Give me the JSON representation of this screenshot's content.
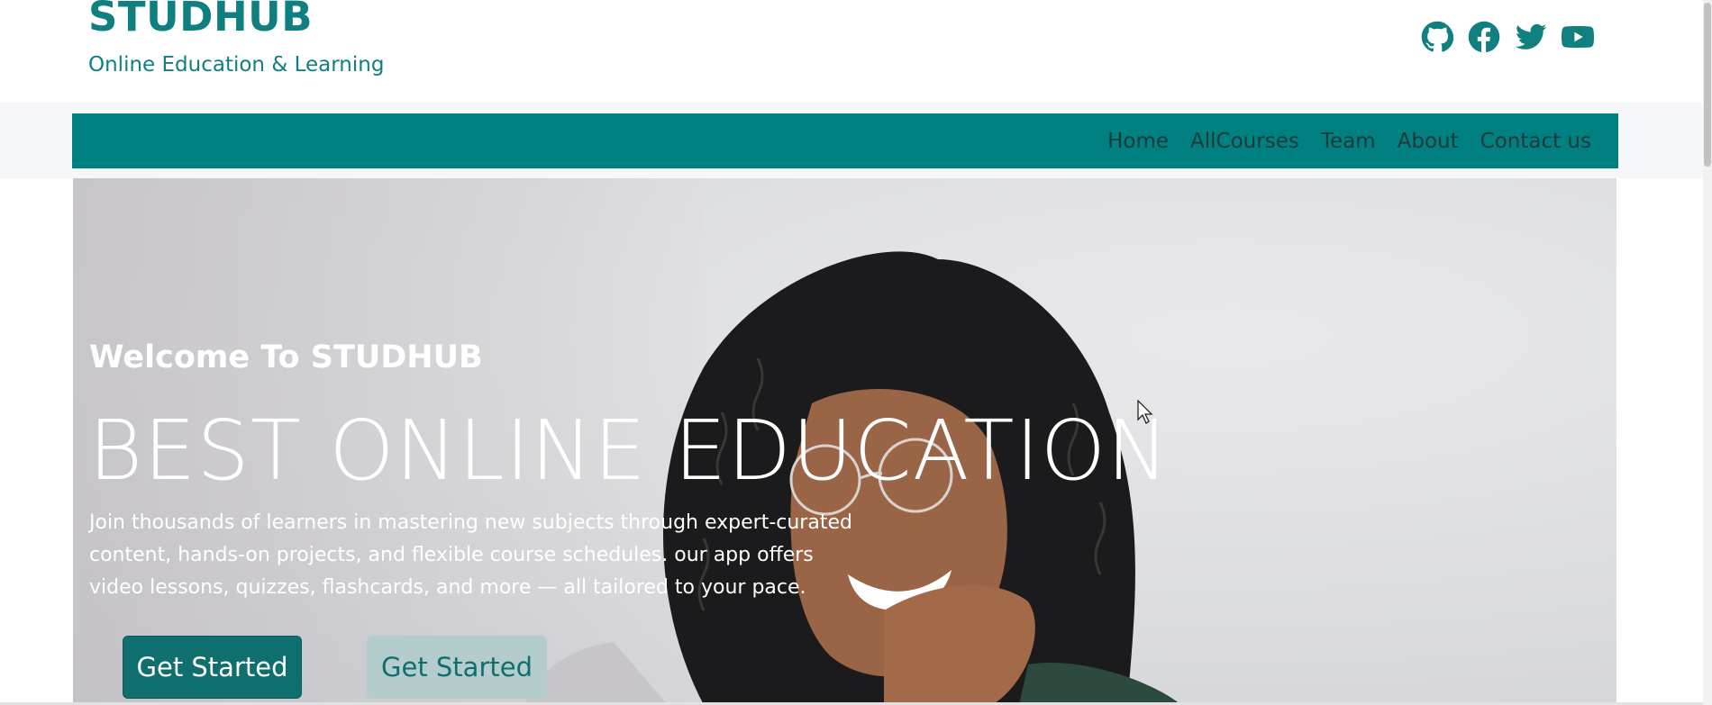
{
  "header": {
    "brand_title": "STUDHUB",
    "brand_subtitle": "Online Education & Learning",
    "social_icons": [
      "github-icon",
      "facebook-icon",
      "twitter-icon",
      "youtube-icon"
    ]
  },
  "nav": {
    "items": [
      {
        "label": "Home"
      },
      {
        "label": "AllCourses"
      },
      {
        "label": "Team"
      },
      {
        "label": "About"
      },
      {
        "label": "Contact us"
      }
    ]
  },
  "hero": {
    "welcome": "Welcome To STUDHUB",
    "title": "BEST ONLINE EDUCATION",
    "description": "Join thousands of learners in mastering new subjects through expert-curated content, hands-on projects, and flexible course schedules. our app offers video lessons, quizzes, flashcards, and more — all tailored to your pace.",
    "primary_button": "Get Started",
    "secondary_button": "Get Started"
  },
  "colors": {
    "brand": "#0f7f7f",
    "navbar": "#008080",
    "primary_button": "#0f6e6e",
    "secondary_button": "#b5cccc"
  }
}
